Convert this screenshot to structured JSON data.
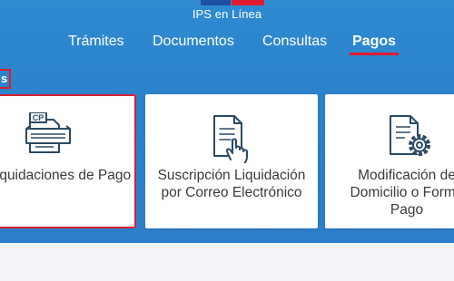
{
  "header": {
    "brand": "IPS en Línea",
    "flag_colors": [
      "#1f4fa3",
      "#e01b2f"
    ]
  },
  "nav": {
    "items": [
      {
        "label": "Trámites"
      },
      {
        "label": "Documentos"
      },
      {
        "label": "Consultas"
      },
      {
        "label": "Pagos",
        "active": true
      }
    ]
  },
  "breadcrumb": {
    "label": "s"
  },
  "cards": [
    {
      "label": "iquidaciones de Pago",
      "icon": "payment-document-icon",
      "selected": true
    },
    {
      "label": "Suscripción Liquidación\npor Correo Electrónico",
      "icon": "document-hand-icon",
      "selected": false
    },
    {
      "label": "Modificación de\nDomicilio o Forma\nPago",
      "icon": "document-gear-icon",
      "selected": false
    }
  ],
  "icon_labels": {
    "cp_badge": "CP"
  },
  "colors": {
    "hero_background": "#2c82ca",
    "accent_red": "#e01b2f",
    "icon_stroke": "#2b4a63",
    "card_background": "#ffffff"
  }
}
